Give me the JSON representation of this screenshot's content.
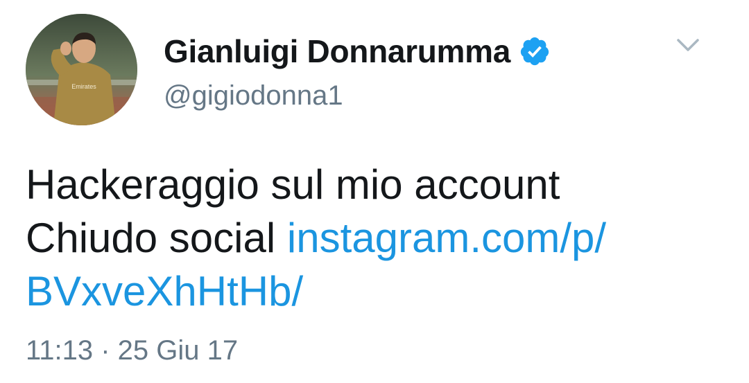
{
  "author": {
    "display_name": "Gianluigi Donnarumma",
    "handle": "@gigiodonna1",
    "verified": true
  },
  "tweet": {
    "line1": "Hackeraggio sul mio account",
    "line2_text": "Chiudo social ",
    "link_part1": "instagram.com/p/",
    "link_part2": "BVxveXhHtHb/"
  },
  "meta": {
    "timestamp": "11:13 · 25 Giu 17"
  },
  "icons": {
    "verified": "verified-badge-icon",
    "menu": "chevron-down-icon"
  },
  "colors": {
    "text": "#14171a",
    "secondary": "#657786",
    "link": "#1b95e0",
    "verified": "#1da1f2"
  }
}
